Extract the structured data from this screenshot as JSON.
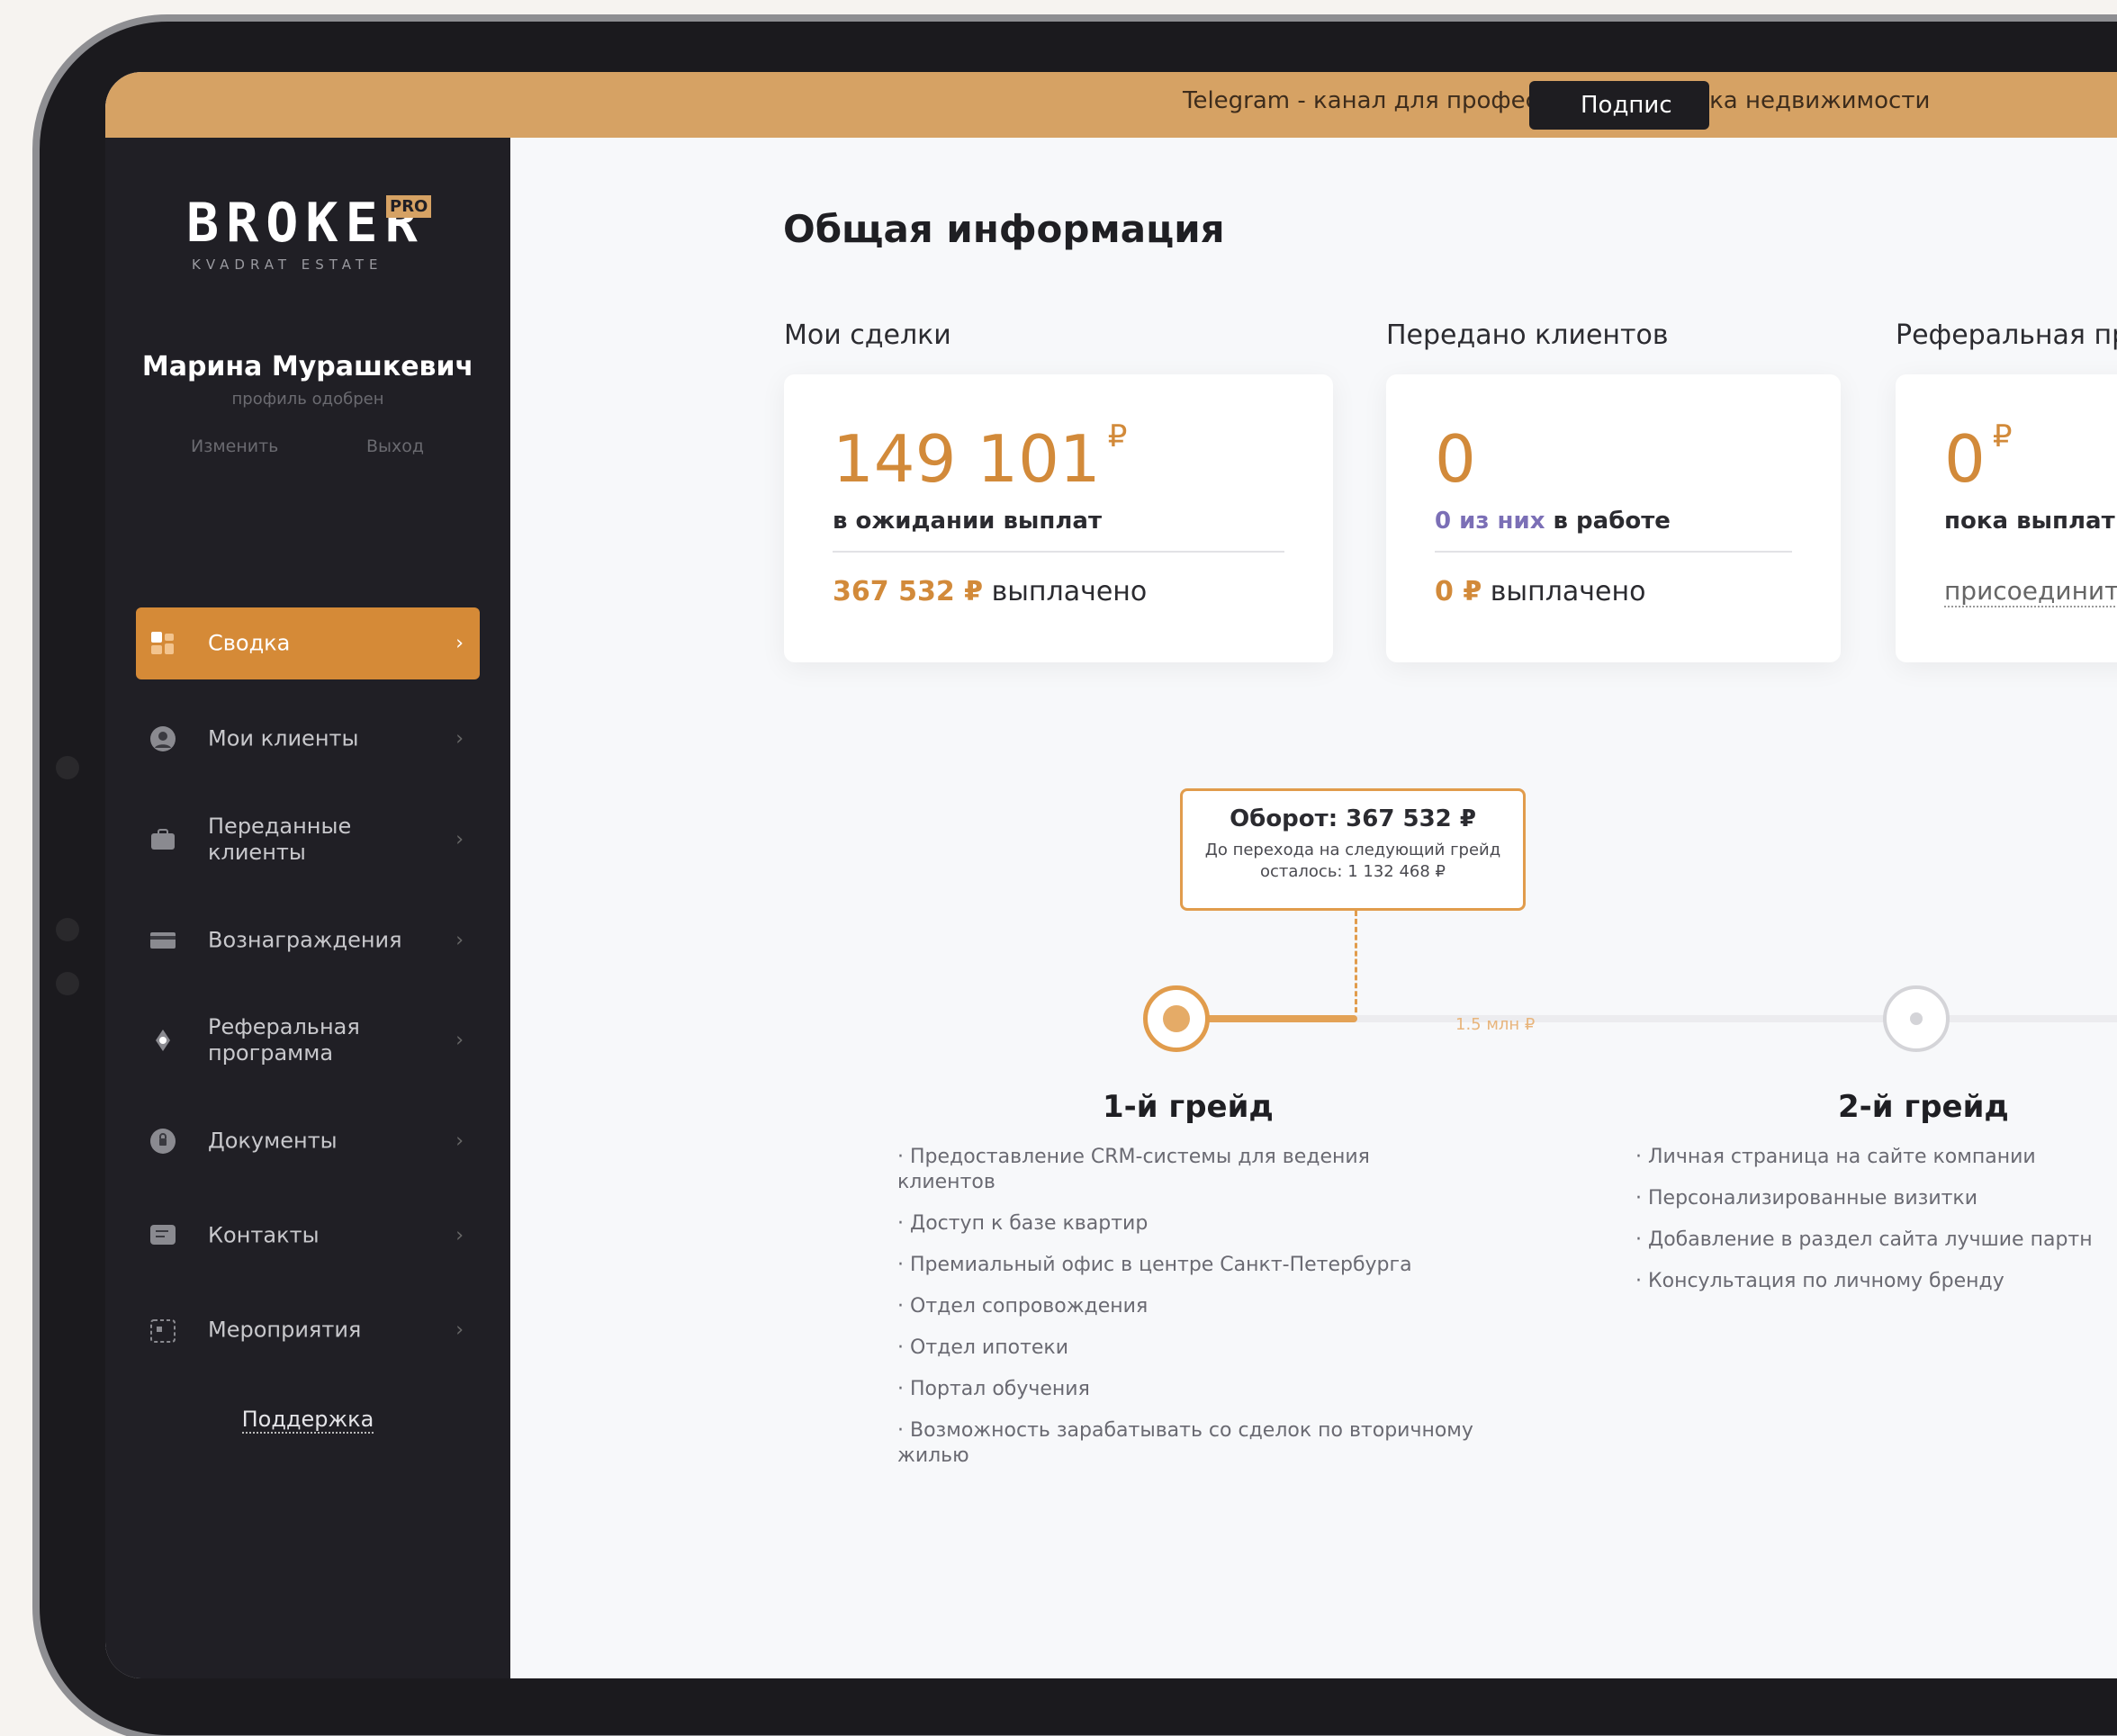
{
  "banner": {
    "text": "Telegram - канал для профессионалов рынка недвижимости",
    "button_label": "Подпис"
  },
  "brand": {
    "logo_main": "BROKER",
    "logo_badge": "PRO",
    "logo_sub": "KVADRAT ESTATE"
  },
  "user": {
    "name": "Марина Мурашкевич",
    "status": "профиль одобрен",
    "edit_label": "Изменить",
    "logout_label": "Выход"
  },
  "nav": {
    "items": [
      {
        "label": "Сводка",
        "icon": "summary-icon",
        "active": true
      },
      {
        "label": "Мои клиенты",
        "icon": "user-icon"
      },
      {
        "label": "Переданные клиенты",
        "icon": "briefcase-icon"
      },
      {
        "label": "Вознаграждения",
        "icon": "card-icon"
      },
      {
        "label": "Реферальная программа",
        "icon": "referral-icon"
      },
      {
        "label": "Документы",
        "icon": "document-icon"
      },
      {
        "label": "Контакты",
        "icon": "contacts-icon"
      },
      {
        "label": "Мероприятия",
        "icon": "events-icon"
      }
    ],
    "support_label": "Поддержка"
  },
  "main": {
    "title": "Общая информация",
    "sections": {
      "deals": {
        "label": "Мои сделки",
        "amount": "149 101",
        "currency": "₽",
        "pending_label": "в ожидании выплат",
        "paid_amount": "367 532 ₽",
        "paid_label": "выплачено"
      },
      "clients": {
        "label": "Передано клиентов",
        "amount": "0",
        "in_work_accent": "0 из них",
        "in_work_label": "в работе",
        "paid_amount": "0 ₽",
        "paid_label": "выплачено"
      },
      "referral": {
        "label": "Реферальная пр",
        "amount": "0",
        "currency": "₽",
        "sub_label": "пока выплат",
        "join_label": "присоединит"
      }
    }
  },
  "progress": {
    "tooltip_title": "Оборот: 367 532 ₽",
    "tooltip_sub": "До перехода на следующий грейд осталось: 1 132 468 ₽",
    "milestone_label": "1.5 млн ₽",
    "turnover": 367532,
    "next_grade_threshold": 1500000,
    "grades": [
      {
        "title": "1-й грейд",
        "benefits": [
          "Предоставление CRM-системы для ведения клиентов",
          "Доступ к базе квартир",
          "Премиальный офис в центре Санкт-Петербурга",
          "Отдел сопровождения",
          "Отдел ипотеки",
          "Портал обучения",
          "Возможность зарабатывать со сделок по вторичному жилью"
        ]
      },
      {
        "title": "2-й грейд",
        "benefits": [
          "Личная страница на сайте компании",
          "Персонализированные визитки",
          "Добавление в раздел сайта лучшие партн",
          "Консультация по личному бренду"
        ]
      }
    ]
  },
  "colors": {
    "accent": "#d58a37",
    "sidebar": "#201f25",
    "banner": "#d6a264"
  }
}
